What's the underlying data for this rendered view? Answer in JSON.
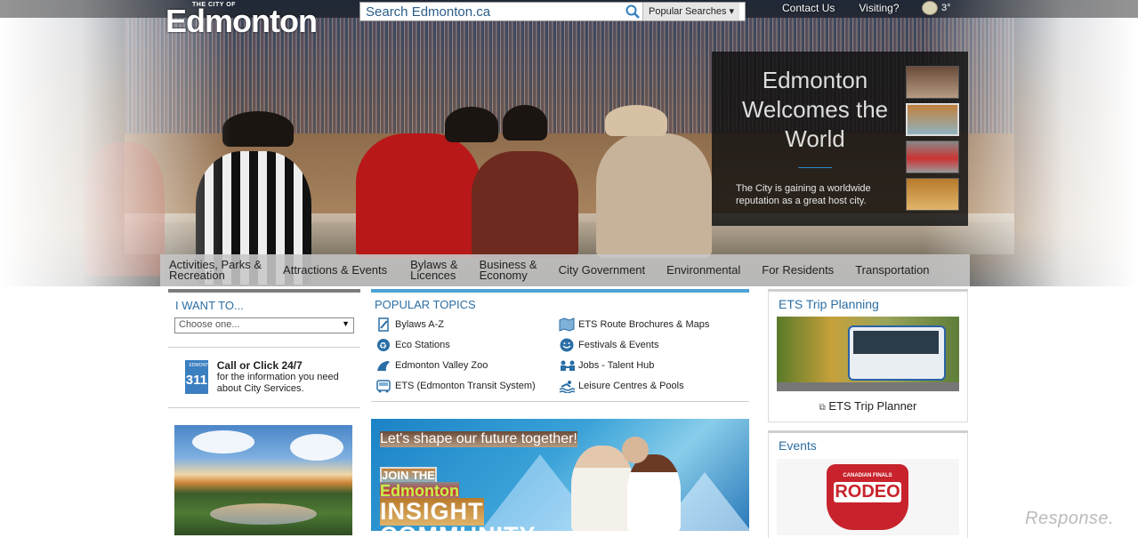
{
  "header": {
    "logo_small": "THE CITY OF",
    "logo_big": "Edmonton",
    "search_placeholder": "Search Edmonton.ca",
    "popular_searches": "Popular Searches",
    "links": [
      "Contact Us",
      "Visiting?"
    ],
    "weather_temp": "3°"
  },
  "feature": {
    "title": "Edmonton Welcomes the World",
    "description": "The City is gaining a worldwide reputation as a great host city."
  },
  "nav": [
    {
      "line1": "Activities, Parks &",
      "line2": "Recreation"
    },
    {
      "line1": "Attractions & Events",
      "line2": ""
    },
    {
      "line1": "Bylaws &",
      "line2": "Licences"
    },
    {
      "line1": "Business &",
      "line2": "Economy"
    },
    {
      "line1": "City Government",
      "line2": ""
    },
    {
      "line1": "Environmental",
      "line2": ""
    },
    {
      "line1": "For Residents",
      "line2": ""
    },
    {
      "line1": "Transportation",
      "line2": ""
    }
  ],
  "iwant": {
    "heading": "I WANT TO...",
    "select_value": "Choose one...",
    "call_badge_small": "EDMONTON",
    "call_badge": "311",
    "call_title": "Call or Click 24/7",
    "call_text": "for the information you need about City Services."
  },
  "popular": {
    "heading": "POPULAR TOPICS",
    "items": [
      "Bylaws A-Z",
      "ETS Route Brochures & Maps",
      "Eco Stations",
      "Festivals & Events",
      "Edmonton Valley Zoo",
      "Jobs - Talent Hub",
      "ETS (Edmonton Transit System)",
      "Leisure Centres & Pools"
    ]
  },
  "banner": {
    "tagline": "Let's shape our future together!",
    "join": "JOIN THE",
    "city": "Edmonton",
    "insight": "INSIGHT",
    "community": "COMMUNITY"
  },
  "ets": {
    "heading": "ETS Trip Planning",
    "link": "ETS Trip Planner"
  },
  "events": {
    "heading": "Events",
    "badge_small": "CANADIAN FINALS",
    "badge_big": "RODEO"
  },
  "watermark": "Response."
}
